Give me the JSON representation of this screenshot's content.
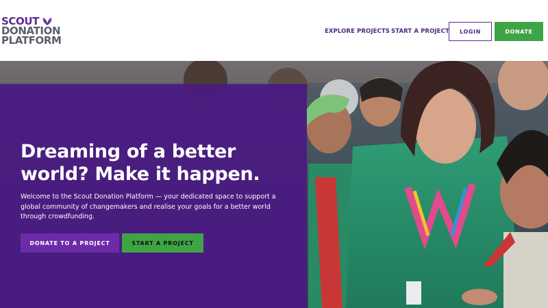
{
  "header": {
    "logo": {
      "line1": "SCOUT",
      "line2": "DONATION",
      "line3": "PLATFORM",
      "leaf_color": "#6a2fa0"
    },
    "nav": {
      "explore_label": "EXPLORE PROJECTS",
      "start_label": "START A PROJECT"
    },
    "login_label": "LOGIN",
    "donate_label": "DONATE"
  },
  "hero": {
    "headline_line1": "Dreaming of a better",
    "headline_line2": "world? Make it happen.",
    "intro": "Welcome to the Scout Donation Platform — your dedicated space to support a global community of changemakers and realise your goals for a better world through crowdfunding.",
    "donate_button_label": "DONATE TO A PROJECT",
    "start_button_label": "START A PROJECT"
  },
  "colors": {
    "brand_purple": "#5a2a91",
    "panel_purple": "#4a1a82",
    "accent_green": "#3fa445"
  }
}
